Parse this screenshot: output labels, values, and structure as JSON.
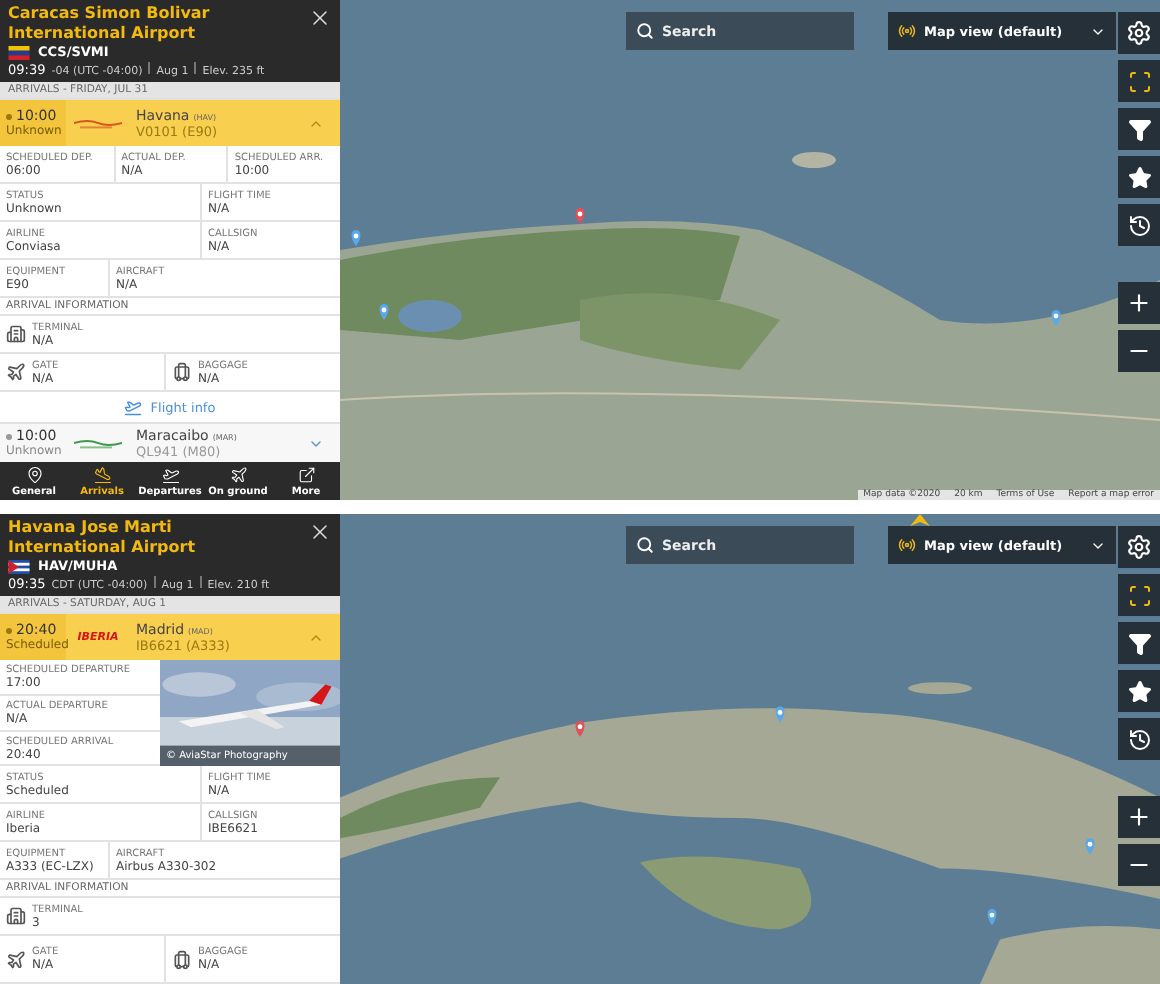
{
  "panels": [
    {
      "airport": {
        "name": "Caracas Simon Bolivar International Airport",
        "code": "CCS/SVMI",
        "time": "09:39",
        "zone": "-04 (UTC -04:00)",
        "date": "Aug 1",
        "elevation": "Elev. 235 ft"
      },
      "list_title": "ARRIVALS - FRIDAY, JUL 31",
      "flights": [
        {
          "time": "10:00",
          "status": "Unknown",
          "logo": {
            "kind": "mark",
            "color": "#d9541e"
          },
          "city": "Havana",
          "city_code": "(HAV)",
          "flight": "V0101 (E90)",
          "selected": true,
          "expanded": true
        },
        {
          "time": "10:00",
          "status": "Unknown",
          "logo": {
            "kind": "mark",
            "color": "#3a9a4a"
          },
          "city": "Maracaibo",
          "city_code": "(MAR)",
          "flight": "QL941 (M80)",
          "selected": false,
          "expanded": false
        }
      ],
      "details": {
        "rows": [
          {
            "kind": "even",
            "cells": [
              {
                "label": "SCHEDULED DEP.",
                "value": "06:00"
              },
              {
                "label": "ACTUAL DEP.",
                "value": "N/A"
              },
              {
                "label": "SCHEDULED ARR.",
                "value": "10:00"
              }
            ]
          },
          {
            "kind": "wide_left",
            "cells": [
              {
                "label": "STATUS",
                "value": "Unknown"
              },
              {
                "label": "FLIGHT TIME",
                "value": "N/A"
              }
            ]
          },
          {
            "kind": "wide_left",
            "cells": [
              {
                "label": "AIRLINE",
                "value": "Conviasa"
              },
              {
                "label": "CALLSIGN",
                "value": "N/A"
              }
            ]
          },
          {
            "kind": "wide_right",
            "cells": [
              {
                "label": "EQUIPMENT",
                "value": "E90"
              },
              {
                "label": "AIRCRAFT",
                "value": "N/A"
              }
            ]
          }
        ],
        "arrival": {
          "title": "ARRIVAL INFORMATION",
          "terminal": {
            "label": "TERMINAL",
            "value": "N/A"
          },
          "gate": {
            "label": "GATE",
            "value": "N/A"
          },
          "baggage": {
            "label": "BAGGAGE",
            "value": "N/A"
          }
        },
        "flight_info": "Flight info"
      },
      "nav": [
        {
          "label": "General",
          "selected": false
        },
        {
          "label": "Arrivals",
          "selected": true
        },
        {
          "label": "Departures",
          "selected": false
        },
        {
          "label": "On ground",
          "selected": false
        },
        {
          "label": "More",
          "selected": false
        }
      ],
      "map": {
        "search": {
          "placeholder": "Search"
        },
        "view": "Map view (default)",
        "footer": [
          "Map data ©2020",
          "20 km",
          "Terms of Use",
          "Report a map error"
        ]
      }
    },
    {
      "airport": {
        "name": "Havana Jose Marti International Airport",
        "code": "HAV/MUHA",
        "time": "09:35",
        "zone": "CDT (UTC -04:00)",
        "date": "Aug 1",
        "elevation": "Elev. 210 ft"
      },
      "list_title": "ARRIVALS - SATURDAY, AUG 1",
      "flights": [
        {
          "time": "20:40",
          "status": "Scheduled",
          "logo": {
            "kind": "wordmark",
            "text": "IBERIA",
            "color": "#d7141a"
          },
          "city": "Madrid",
          "city_code": "(MAD)",
          "flight": "IB6621 (A333)",
          "selected": true,
          "expanded": true
        }
      ],
      "details": {
        "photo": {
          "caption": "© AviaStar Photography",
          "fields": [
            {
              "label": "SCHEDULED DEPARTURE",
              "value": "17:00"
            },
            {
              "label": "ACTUAL DEPARTURE",
              "value": "N/A"
            },
            {
              "label": "SCHEDULED ARRIVAL",
              "value": "20:40"
            }
          ]
        },
        "rows": [
          {
            "kind": "wide_left",
            "cells": [
              {
                "label": "STATUS",
                "value": "Scheduled"
              },
              {
                "label": "FLIGHT TIME",
                "value": "N/A"
              }
            ]
          },
          {
            "kind": "wide_left",
            "cells": [
              {
                "label": "AIRLINE",
                "value": "Iberia"
              },
              {
                "label": "CALLSIGN",
                "value": "IBE6621"
              }
            ]
          },
          {
            "kind": "wide_right",
            "cells": [
              {
                "label": "EQUIPMENT",
                "value": "A333 (EC-LZX)"
              },
              {
                "label": "AIRCRAFT",
                "value": "Airbus A330-302"
              }
            ]
          }
        ],
        "arrival": {
          "title": "ARRIVAL INFORMATION",
          "terminal": {
            "label": "TERMINAL",
            "value": "3"
          },
          "gate": {
            "label": "GATE",
            "value": "N/A"
          },
          "baggage": {
            "label": "BAGGAGE",
            "value": "N/A"
          }
        }
      },
      "map": {
        "search": {
          "placeholder": "Search"
        },
        "view": "Map view (default)"
      }
    }
  ]
}
